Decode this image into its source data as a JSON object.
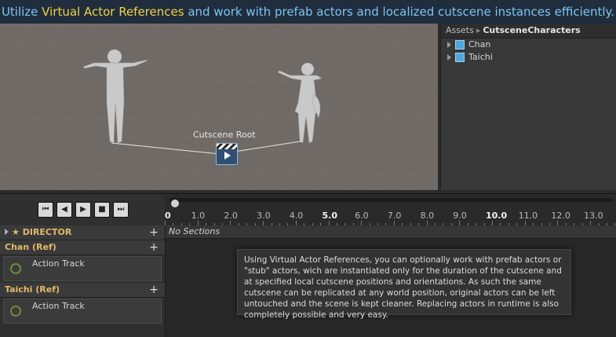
{
  "banner": {
    "pre": "Utilize ",
    "highlight": "Virtual Actor References",
    "post": " and work with prefab actors and localized cutscene instances efficiently."
  },
  "scene": {
    "root_label": "Cutscene Root"
  },
  "hierarchy": {
    "crumb_root": "Assets",
    "crumb_current": "CutsceneCharacters",
    "items": [
      {
        "label": "Chan"
      },
      {
        "label": "Taichi"
      }
    ]
  },
  "controls": {
    "icons": [
      "skip-start-icon",
      "step-back-icon",
      "play-icon",
      "stop-icon",
      "skip-end-icon"
    ]
  },
  "ruler": {
    "ticks": [
      "0",
      "1.0",
      "2.0",
      "3.0",
      "4.0",
      "5.0",
      "6.0",
      "7.0",
      "8.0",
      "9.0",
      "10.0",
      "11.0",
      "12.0",
      "13.0"
    ],
    "major": [
      "0",
      "5.0",
      "10.0"
    ]
  },
  "tracks": {
    "director": {
      "label": "DIRECTOR",
      "star": "★",
      "add": "+"
    },
    "groups": [
      {
        "label": "Chan (Ref)",
        "add": "+",
        "track": "Action Track"
      },
      {
        "label": "Taichi (Ref)",
        "add": "+",
        "track": "Action Track"
      }
    ],
    "no_sections": "No Sections"
  },
  "tooltip": {
    "text": "Using Virtual Actor References, you can optionally work with prefab actors or \"stub\" actors, wich are instantiated only for the duration of the cutscene and at specified local cutscene positions and orientations. As such the same cutscene can be replicated at any world position, original actors can be left untouched and the scene is kept cleaner. Replacing actors in runtime is also completely possible and very easy."
  },
  "colors": {
    "banner_text": "#7fc4f2",
    "banner_highlight": "#f0d24a",
    "group_label": "#e0b96a",
    "scene_bg": "#6f6a66"
  }
}
